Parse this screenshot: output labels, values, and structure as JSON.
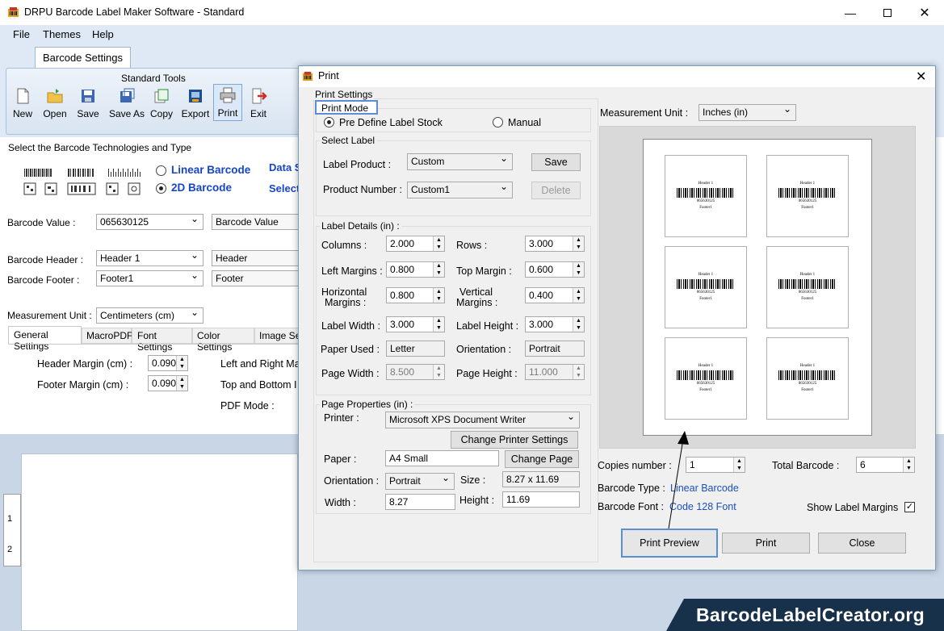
{
  "window": {
    "title": "DRPU Barcode Label Maker Software - Standard"
  },
  "menu": {
    "file": "File",
    "themes": "Themes",
    "help": "Help"
  },
  "ribbon": {
    "tab": "Barcode Settings",
    "group_title": "Standard Tools",
    "tools": [
      "New",
      "Open",
      "Save",
      "Save As",
      "Copy",
      "Export",
      "Print",
      "Exit"
    ]
  },
  "left": {
    "select_tech_label": "Select the Barcode Technologies and Type",
    "linear_barcode": "Linear Barcode",
    "barcode_2d": "2D Barcode",
    "data_label": "Data S",
    "select_label": "Select",
    "barcode_value_label": "Barcode Value :",
    "barcode_value": "065630125",
    "barcode_value_btn": "Barcode Value",
    "barcode_header_label": "Barcode Header :",
    "barcode_header": "Header 1",
    "barcode_header_btn": "Header",
    "barcode_footer_label": "Barcode Footer :",
    "barcode_footer": "Footer1",
    "barcode_footer_btn": "Footer",
    "measurement_label": "Measurement Unit :",
    "measurement_value": "Centimeters (cm)",
    "tabs": [
      "General Settings",
      "MacroPDF",
      "Font Settings",
      "Color Settings",
      "Image Set"
    ],
    "header_margin_label": "Header Margin (cm) :",
    "header_margin": "0.090",
    "footer_margin_label": "Footer Margin (cm) :",
    "footer_margin": "0.090",
    "lr_margin_label": "Left and Right Ma",
    "tb_margin_label": "Top and Bottom I",
    "pdf_mode_label": "PDF Mode :",
    "ruler_1": "1",
    "ruler_2": "2"
  },
  "dialog": {
    "title": "Print",
    "print_settings": "Print Settings",
    "print_mode": "Print Mode",
    "predefine": "Pre Define Label Stock",
    "manual": "Manual",
    "select_label": "Select Label",
    "label_product_label": "Label Product :",
    "label_product": "Custom",
    "save": "Save",
    "product_number_label": "Product Number :",
    "product_number": "Custom1",
    "delete": "Delete",
    "label_details": "Label Details (in) :",
    "columns_label": "Columns :",
    "columns": "2.000",
    "rows_label": "Rows :",
    "rows": "3.000",
    "left_margins_label": "Left Margins :",
    "left_margins": "0.800",
    "top_margin_label": "Top Margin :",
    "top_margin": "0.600",
    "horizontal_margins_label1": "Horizontal",
    "horizontal_margins_label2": "Margins :",
    "horizontal_margins": "0.800",
    "vertical_margins_label1": "Vertical",
    "vertical_margins_label2": "Margins :",
    "vertical_margins": "0.400",
    "label_width_label": "Label Width :",
    "label_width": "3.000",
    "label_height_label": "Label Height :",
    "label_height": "3.000",
    "paper_used_label": "Paper Used :",
    "paper_used": "Letter",
    "orientation_label": "Orientation :",
    "orientation": "Portrait",
    "page_width_label": "Page Width :",
    "page_width": "8.500",
    "page_height_label": "Page Height :",
    "page_height": "11.000",
    "page_properties": "Page Properties (in) :",
    "printer_label": "Printer :",
    "printer": "Microsoft XPS Document Writer",
    "change_printer": "Change Printer Settings",
    "paper_label": "Paper :",
    "paper": "A4 Small",
    "change_page": "Change Page",
    "p_orientation_label": "Orientation :",
    "p_orientation": "Portrait",
    "size_label": "Size :",
    "size": "8.27 x 11.69",
    "width_label": "Width :",
    "width": "8.27",
    "height_label": "Height :",
    "height": "11.69",
    "measurement_unit_label": "Measurement Unit :",
    "measurement_unit": "Inches (in)",
    "preview_label": {
      "header": "Header 1",
      "value": "065630125",
      "footer": "Footer1"
    },
    "copies_label": "Copies number :",
    "copies": "1",
    "total_barcode_label": "Total Barcode :",
    "total_barcode": "6",
    "barcode_type_label": "Barcode Type :",
    "barcode_type": "Linear Barcode",
    "barcode_font_label": "Barcode Font :",
    "barcode_font": "Code 128 Font",
    "show_label_margins": "Show Label Margins",
    "print_preview": "Print Preview",
    "print": "Print",
    "close": "Close"
  },
  "watermark": "BarcodeLabelCreator.org"
}
